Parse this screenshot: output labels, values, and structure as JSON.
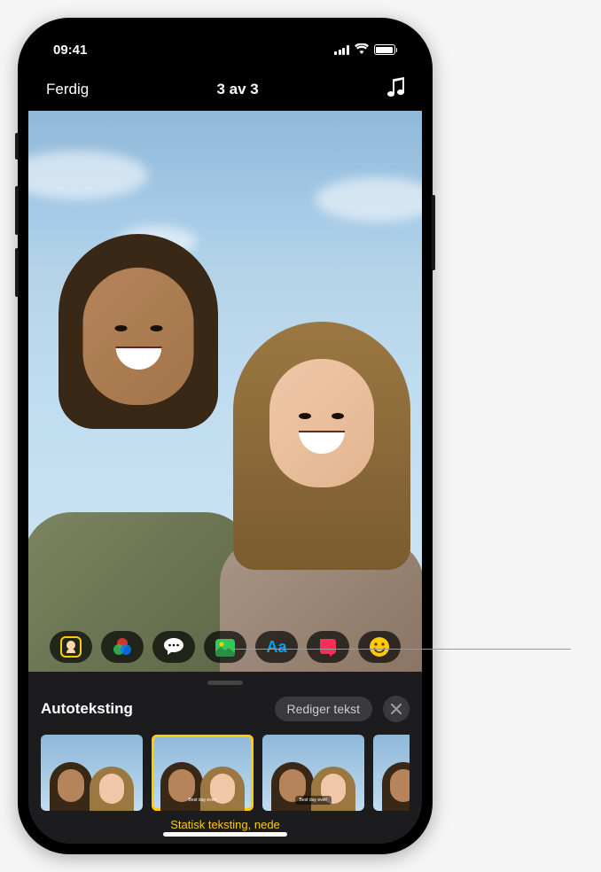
{
  "status": {
    "time": "09:41"
  },
  "header": {
    "done_label": "Ferdig",
    "counter": "3 av 3"
  },
  "toolbar": {
    "icons": {
      "memoji": "memoji-icon",
      "filters": "filters-icon",
      "speech": "speech-bubble-icon",
      "stickers": "stickers-icon",
      "text": "text-icon",
      "shapes": "shapes-icon",
      "emoji": "emoji-icon"
    }
  },
  "caption_panel": {
    "title": "Autoteksting",
    "edit_label": "Rediger tekst",
    "selected_label": "Statisk teksting, nede",
    "thumb_text": "Best day ever!"
  }
}
